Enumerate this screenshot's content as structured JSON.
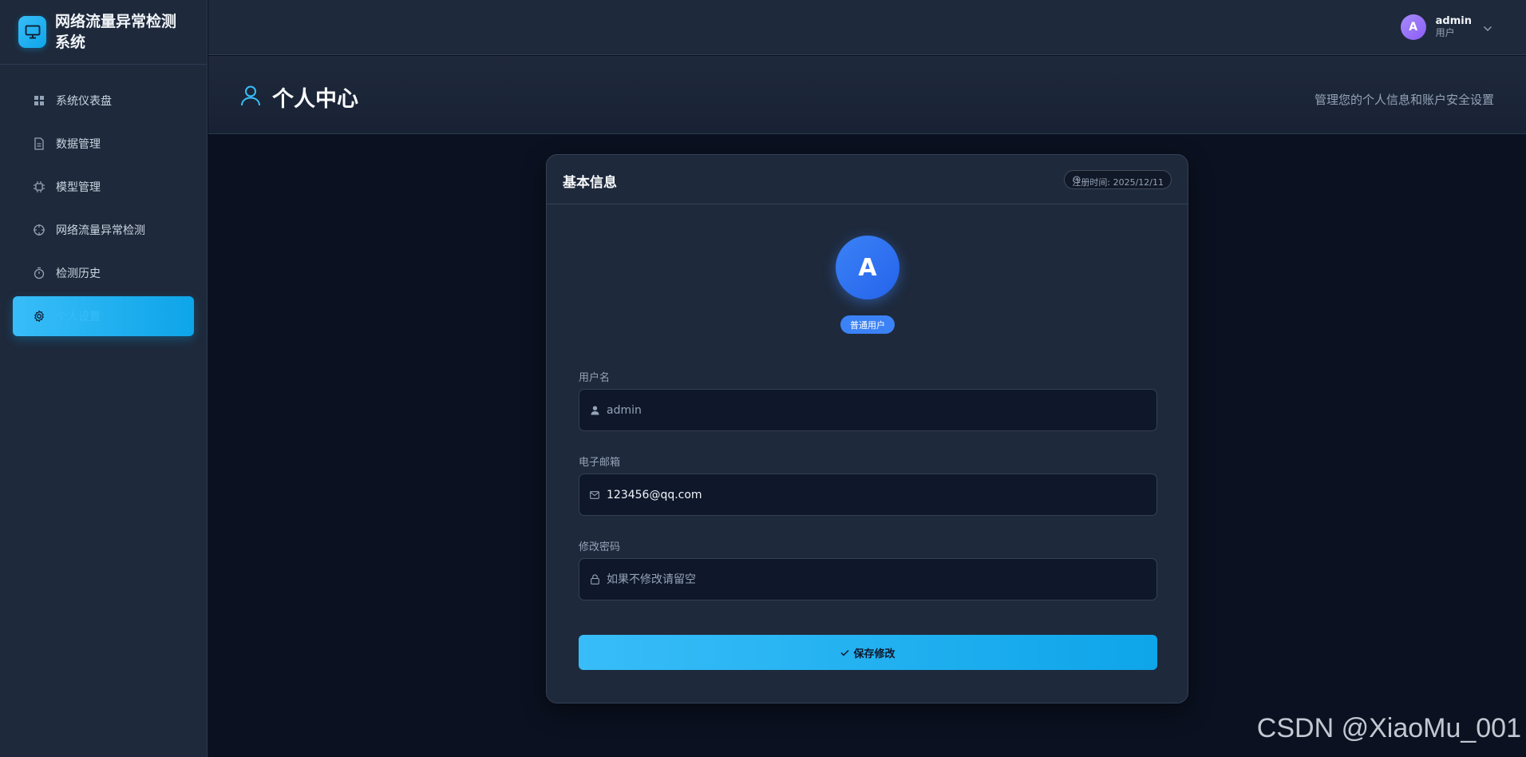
{
  "sidebar": {
    "brand_title": "网络流量异常检测系统",
    "items": [
      {
        "label": "系统仪表盘",
        "icon": "grid-icon"
      },
      {
        "label": "数据管理",
        "icon": "file-icon"
      },
      {
        "label": "模型管理",
        "icon": "chip-icon"
      },
      {
        "label": "网络流量异常检测",
        "icon": "crosshair-icon"
      },
      {
        "label": "检测历史",
        "icon": "stopwatch-icon"
      },
      {
        "label": "个人设置",
        "icon": "gear-icon",
        "active": true
      }
    ]
  },
  "topbar": {
    "avatar_letter": "A",
    "username": "admin",
    "role": "用户"
  },
  "page_header": {
    "title": "个人中心",
    "subtitle": "管理您的个人信息和账户安全设置"
  },
  "card": {
    "title": "基本信息",
    "register_time": "注册时间: 2025/12/11",
    "avatar_letter": "A",
    "role_badge": "普通用户",
    "fields": {
      "username": {
        "label": "用户名",
        "placeholder": "admin",
        "value": ""
      },
      "email": {
        "label": "电子邮箱",
        "value": "123456@qq.com"
      },
      "password": {
        "label": "修改密码",
        "placeholder": "如果不修改请留空",
        "value": ""
      }
    },
    "save_label": "保存修改"
  },
  "watermark": "CSDN @XiaoMu_001",
  "colors": {
    "accent": "#0ea5e9",
    "background": "#0b1120",
    "panel": "#1e293b"
  }
}
